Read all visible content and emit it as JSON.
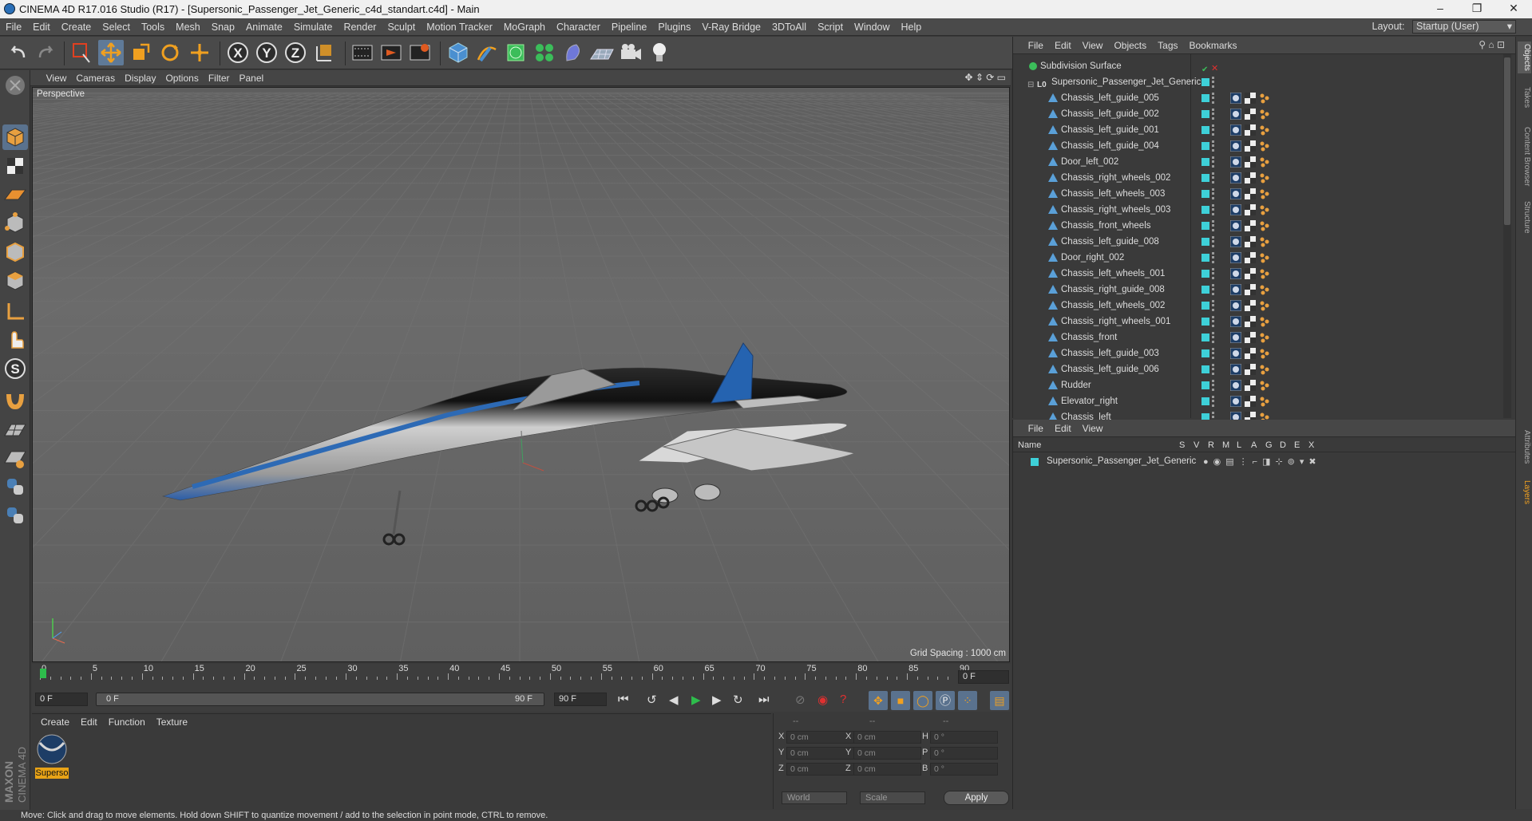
{
  "window": {
    "title": "CINEMA 4D R17.016 Studio (R17) - [Supersonic_Passenger_Jet_Generic_c4d_standart.c4d] - Main"
  },
  "menubar": [
    "File",
    "Edit",
    "Create",
    "Select",
    "Tools",
    "Mesh",
    "Snap",
    "Animate",
    "Simulate",
    "Render",
    "Sculpt",
    "Motion Tracker",
    "MoGraph",
    "Character",
    "Pipeline",
    "Plugins",
    "V-Ray Bridge",
    "3DToAll",
    "Script",
    "Window",
    "Help"
  ],
  "layout": {
    "label": "Layout:",
    "value": "Startup (User)"
  },
  "viewport": {
    "menu": [
      "View",
      "Cameras",
      "Display",
      "Options",
      "Filter",
      "Panel"
    ],
    "camera_label": "Perspective",
    "grid_spacing": "Grid Spacing : 1000 cm"
  },
  "timeline": {
    "ticks": [
      "0",
      "5",
      "10",
      "15",
      "20",
      "25",
      "30",
      "35",
      "40",
      "45",
      "50",
      "55",
      "60",
      "65",
      "70",
      "75",
      "80",
      "85",
      "90"
    ],
    "current_frame": "0 F",
    "start_field": "0 F",
    "range_start": "0 F",
    "range_end": "90 F",
    "end_field": "90 F"
  },
  "material_manager": {
    "menu": [
      "Create",
      "Edit",
      "Function",
      "Texture"
    ],
    "materials": [
      {
        "label": "Superso"
      }
    ]
  },
  "coordinates": {
    "header": [
      "--",
      "--",
      "--"
    ],
    "rows": [
      {
        "a_label": "X",
        "a_val": "0 cm",
        "b_label": "X",
        "b_val": "0 cm",
        "c_label": "H",
        "c_val": "0 °"
      },
      {
        "a_label": "Y",
        "a_val": "0 cm",
        "b_label": "Y",
        "b_val": "0 cm",
        "c_label": "P",
        "c_val": "0 °"
      },
      {
        "a_label": "Z",
        "a_val": "0 cm",
        "b_label": "Z",
        "b_val": "0 cm",
        "c_label": "B",
        "c_val": "0 °"
      }
    ],
    "mode": "World",
    "scale": "Scale",
    "apply": "Apply"
  },
  "object_manager": {
    "menu": [
      "File",
      "Edit",
      "View",
      "Objects",
      "Tags",
      "Bookmarks"
    ],
    "root": "Subdivision Surface",
    "group": "Supersonic_Passenger_Jet_Generic",
    "items": [
      "Chassis_left_guide_005",
      "Chassis_left_guide_002",
      "Chassis_left_guide_001",
      "Chassis_left_guide_004",
      "Door_left_002",
      "Chassis_right_wheels_002",
      "Chassis_left_wheels_003",
      "Chassis_right_wheels_003",
      "Chassis_front_wheels",
      "Chassis_left_guide_008",
      "Door_right_002",
      "Chassis_left_wheels_001",
      "Chassis_right_guide_008",
      "Chassis_left_wheels_002",
      "Chassis_right_wheels_001",
      "Chassis_front",
      "Chassis_left_guide_003",
      "Chassis_left_guide_006",
      "Rudder",
      "Elevator_right",
      "Chassis_left"
    ]
  },
  "layer_manager": {
    "menu": [
      "File",
      "Edit",
      "View"
    ],
    "columns": [
      "Name",
      "S",
      "V",
      "R",
      "M",
      "L",
      "A",
      "G",
      "D",
      "E",
      "X"
    ],
    "layer": "Supersonic_Passenger_Jet_Generic",
    "layer_color": "#e8a317"
  },
  "right_tabs": [
    "Objects",
    "Takes",
    "Content Browser",
    "Structure",
    "Attributes",
    "Layers"
  ],
  "status": "Move: Click and drag to move elements. Hold down SHIFT to quantize movement / add to the selection in point mode, CTRL to remove.",
  "branding": {
    "line1": "MAXON",
    "line2": "CINEMA 4D"
  },
  "colors": {
    "accent_cyan": "#3ed0d8",
    "selection_orange": "#e8a317",
    "active_tool": "#5a728e"
  }
}
